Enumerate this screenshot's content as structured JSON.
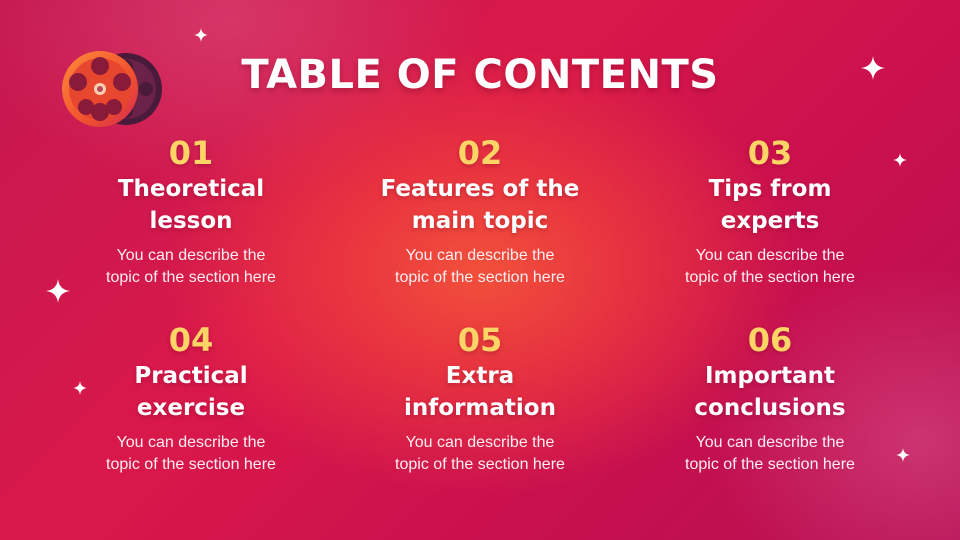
{
  "title": "TABLE OF CONTENTS",
  "colors": {
    "number": "#ffd466",
    "text": "#ffffff",
    "background": "#d3184c"
  },
  "icons": {
    "logo": "film-reel-icon",
    "decoration": "sparkle-icon"
  },
  "sections": [
    {
      "number": "01",
      "heading_line1": "Theoretical",
      "heading_line2": "lesson",
      "desc_line1": "You can describe the",
      "desc_line2": "topic of the section here"
    },
    {
      "number": "02",
      "heading_line1": "Features of the",
      "heading_line2": "main topic",
      "desc_line1": "You can describe the",
      "desc_line2": "topic of the section here"
    },
    {
      "number": "03",
      "heading_line1": "Tips from",
      "heading_line2": "experts",
      "desc_line1": "You can describe the",
      "desc_line2": "topic of the section here"
    },
    {
      "number": "04",
      "heading_line1": "Practical",
      "heading_line2": "exercise",
      "desc_line1": "You can describe the",
      "desc_line2": "topic of the section here"
    },
    {
      "number": "05",
      "heading_line1": "Extra",
      "heading_line2": "information",
      "desc_line1": "You can describe the",
      "desc_line2": "topic of the section here"
    },
    {
      "number": "06",
      "heading_line1": "Important",
      "heading_line2": "conclusions",
      "desc_line1": "You can describe the",
      "desc_line2": "topic of the section here"
    }
  ]
}
